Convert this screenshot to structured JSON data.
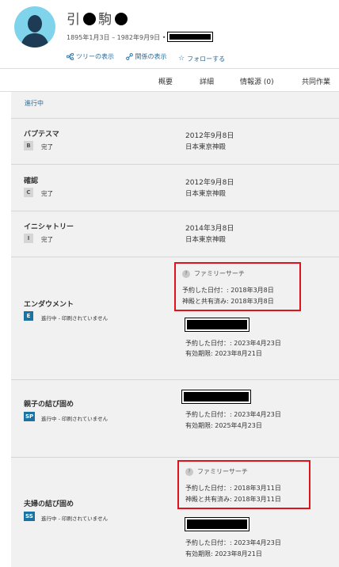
{
  "person": {
    "name_start": "引",
    "name_mid": "駒",
    "lifespan": "1895年1月3日 – 1982年9月9日 •"
  },
  "links": {
    "tree": "ツリーの表示",
    "relationship": "関係の表示",
    "follow": "フォローする"
  },
  "tabs": [
    "概要",
    "詳細",
    "情報源 (0)",
    "共同作業"
  ],
  "status_header": "進行中",
  "familysearch_label": "ファミリーサーチ",
  "ordinances": [
    {
      "name": "バプテスマ",
      "badge": "B",
      "status": "完了",
      "date": "2012年9月8日",
      "place": "日本東京神殿"
    },
    {
      "name": "確認",
      "badge": "C",
      "status": "完了",
      "date": "2012年9月8日",
      "place": "日本東京神殿"
    },
    {
      "name": "イニシャトリー",
      "badge": "I",
      "status": "完了",
      "date": "2014年3月8日",
      "place": "日本東京神殿"
    },
    {
      "name": "エンダウメント",
      "badge": "E",
      "status": "進行中 - 印刷されていません",
      "fs_reserved": "予約した日付：: 2018年3月8日",
      "fs_shared": "神殿と共有済み: 2018年3月8日",
      "reserved": "予約した日付：: 2023年4月23日",
      "expires": "有効期限: 2023年8月21日"
    },
    {
      "name": "親子の結び固め",
      "badge": "SP",
      "status": "進行中 - 印刷されていません",
      "reserved": "予約した日付：: 2023年4月23日",
      "expires": "有効期限: 2025年4月23日"
    },
    {
      "name": "夫婦の結び固め",
      "badge": "SS",
      "status": "進行中 - 印刷されていません",
      "fs_reserved": "予約した日付：: 2018年3月11日",
      "fs_shared": "神殿と共有済み: 2018年3月11日",
      "reserved": "予約した日付：: 2023年4月23日",
      "expires": "有効期限: 2023年8月21日"
    }
  ],
  "colors": {
    "link": "#2a6b98",
    "highlight": "#e0121c",
    "badge_active": "#1b73a4",
    "panel": "#f1f1f1"
  }
}
